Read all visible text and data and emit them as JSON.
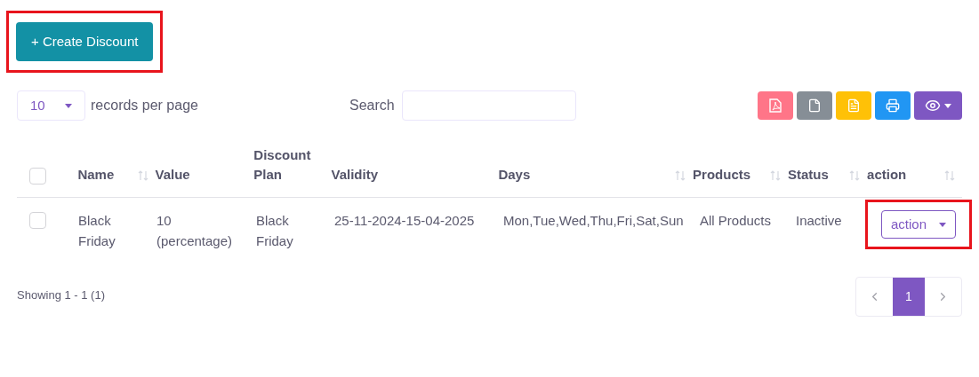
{
  "create_button": {
    "label": "+ Create Discount",
    "highlighted": true
  },
  "page_size": {
    "value": "10",
    "label": "records per page"
  },
  "search": {
    "label": "Search"
  },
  "export_buttons": [
    {
      "kind": "pdf",
      "color": "#ff7588"
    },
    {
      "kind": "file",
      "color": "#868e96"
    },
    {
      "kind": "sheet",
      "color": "#ffc107"
    },
    {
      "kind": "print",
      "color": "#2196f3"
    },
    {
      "kind": "columns",
      "color": "#7e57c2"
    }
  ],
  "table": {
    "all_checked": false,
    "columns": [
      {
        "label": "Name",
        "sortable": true
      },
      {
        "label": "Value",
        "sortable": false
      },
      {
        "label": "Discount Plan",
        "sortable": false
      },
      {
        "label": "Validity",
        "sortable": false
      },
      {
        "label": "Days",
        "sortable": true
      },
      {
        "label": "Products",
        "sortable": true
      },
      {
        "label": "Status",
        "sortable": true
      },
      {
        "label": "action",
        "sortable": true
      }
    ],
    "rows": [
      {
        "checked": false,
        "cells": [
          "Black Friday",
          "10 (percentage)",
          "Black Friday",
          "25-11-2024-15-04-2025",
          "Mon,Tue,Wed,Thu,Fri,Sat,Sun",
          "All Products",
          "Inactive"
        ],
        "action": {
          "label": "action",
          "highlighted": true
        }
      }
    ]
  },
  "footer": {
    "summary": "Showing 1 - 1 (1)"
  },
  "pagination": {
    "pages": [
      {
        "label": "1",
        "selected": true
      }
    ]
  }
}
